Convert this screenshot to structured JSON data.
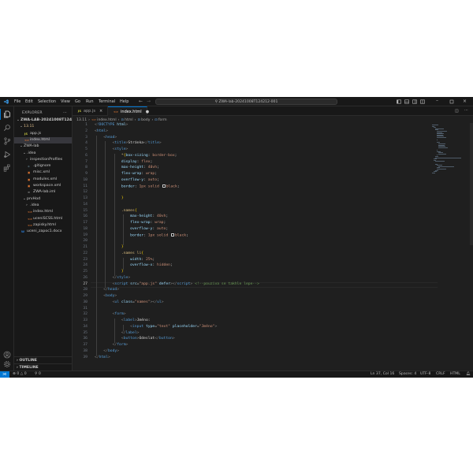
{
  "titlebar": {
    "menu": [
      "File",
      "Edit",
      "Selection",
      "View",
      "Go",
      "Run",
      "Terminal",
      "Help"
    ],
    "command_center": "ZWA-lab-20241008T124212-001"
  },
  "sidebar": {
    "title": "EXPLORER",
    "tree": [
      {
        "label": "ZWA-LAB-20241008T1242...",
        "indent": 0,
        "twisty": "⌄",
        "bold": true,
        "color": "#cccccc"
      },
      {
        "label": "13.11",
        "indent": 1,
        "twisty": "⌄",
        "color": "#e2c08d"
      },
      {
        "label": "app.js",
        "indent": 2,
        "icon": "JS",
        "icon_color": "#cbcb41",
        "color": "#cccccc"
      },
      {
        "label": "index.html",
        "indent": 2,
        "icon": "<>",
        "icon_color": "#e37933",
        "color": "#cccccc",
        "selected": true
      },
      {
        "label": "ZWA-lab",
        "indent": 1,
        "twisty": "⌄",
        "color": "#cccccc"
      },
      {
        "label": ".idea",
        "indent": 2,
        "twisty": "⌄",
        "color": "#cccccc"
      },
      {
        "label": "inspectionProfiles",
        "indent": 3,
        "twisty": "›",
        "color": "#cccccc"
      },
      {
        "label": ".gitignore",
        "indent": 3,
        "icon": "◆",
        "icon_color": "#41535b",
        "color": "#cccccc"
      },
      {
        "label": "misc.xml",
        "indent": 3,
        "icon": "▣",
        "icon_color": "#e37933",
        "color": "#cccccc"
      },
      {
        "label": "modules.xml",
        "indent": 3,
        "icon": "▣",
        "icon_color": "#e37933",
        "color": "#cccccc"
      },
      {
        "label": "workspace.xml",
        "indent": 3,
        "icon": "▣",
        "icon_color": "#e37933",
        "color": "#cccccc"
      },
      {
        "label": "ZWA-lab.iml",
        "indent": 3,
        "icon": "≡",
        "icon_color": "#8a8a8a",
        "color": "#cccccc"
      },
      {
        "label": "prvHod",
        "indent": 2,
        "twisty": "⌄",
        "color": "#cccccc"
      },
      {
        "label": ".idea",
        "indent": 3,
        "twisty": "›",
        "color": "#cccccc"
      },
      {
        "label": "index.html",
        "indent": 3,
        "icon": "<>",
        "icon_color": "#e37933",
        "color": "#cccccc"
      },
      {
        "label": "uceniSCSS.html",
        "indent": 3,
        "icon": "<>",
        "icon_color": "#e37933",
        "color": "#cccccc"
      },
      {
        "label": "zapisky.html",
        "indent": 3,
        "icon": "<>",
        "icon_color": "#e37933",
        "color": "#cccccc"
      },
      {
        "label": "uceni_zapoc1.docx",
        "indent": 1,
        "icon": "W",
        "icon_color": "#2b7cd3",
        "color": "#cccccc"
      }
    ],
    "outline": "OUTLINE",
    "timeline": "TIMELINE"
  },
  "tabs": [
    {
      "label": "app.js",
      "icon": "JS",
      "icon_color": "#cbcb41",
      "active": false,
      "close": "×"
    },
    {
      "label": "index.html",
      "icon": "<>",
      "icon_color": "#e37933",
      "active": true,
      "close": "●"
    }
  ],
  "breadcrumb": [
    "13.11",
    "index.html",
    "html",
    "body",
    "form"
  ],
  "editor": {
    "current_line": 27,
    "lines": [
      {
        "n": 1,
        "html": "<span class=\"p\">&lt;</span><span class=\"t\">!DOCTYPE</span> <span class=\"a\">html</span><span class=\"p\">&gt;</span>"
      },
      {
        "n": 2,
        "html": "<span class=\"p\">&lt;</span><span class=\"t\">html</span><span class=\"p\">&gt;</span>"
      },
      {
        "n": 3,
        "html": "    <span class=\"p\">&lt;</span><span class=\"t\">head</span><span class=\"p\">&gt;</span>"
      },
      {
        "n": 4,
        "html": "        <span class=\"p\">&lt;</span><span class=\"t\">title</span><span class=\"p\">&gt;</span><span class=\"x\">Stránka</span><span class=\"p\">&lt;/</span><span class=\"t\">title</span><span class=\"p\">&gt;</span>"
      },
      {
        "n": 5,
        "html": "        <span class=\"p\">&lt;</span><span class=\"t\">style</span><span class=\"p\">&gt;</span>"
      },
      {
        "n": 6,
        "html": "            <span class=\"sel-t\">*</span><span class=\"y\">{</span><span class=\"a\">box-sizing</span>: <span class=\"v\">border-box</span>;"
      },
      {
        "n": 7,
        "html": "            <span class=\"a\">display</span>: <span class=\"v\">flex</span>;"
      },
      {
        "n": 8,
        "html": "            <span class=\"a\">max-height</span>: <span class=\"v\">40vh</span>;"
      },
      {
        "n": 9,
        "html": "            <span class=\"a\">flex-wrap</span>: <span class=\"v\">wrap</span>;"
      },
      {
        "n": 10,
        "html": "            <span class=\"a\">overflow-y</span>: <span class=\"v\">auto</span>;"
      },
      {
        "n": 11,
        "html": "            <span class=\"a\">border</span>: <span class=\"v\">1px solid</span> <span class=\"sw\"></span><span class=\"v\">black</span>;"
      },
      {
        "n": 12,
        "html": ""
      },
      {
        "n": 13,
        "html": "            <span class=\"y\">}</span>"
      },
      {
        "n": 14,
        "html": ""
      },
      {
        "n": 15,
        "html": "            <span class=\"sel-t\">.names</span><span class=\"y\">{</span>"
      },
      {
        "n": 16,
        "html": "                <span class=\"a\">max-height</span>: <span class=\"v\">40vh</span>;"
      },
      {
        "n": 17,
        "html": "                <span class=\"a\">flex-wrap</span>: <span class=\"v\">wrap</span>;"
      },
      {
        "n": 18,
        "html": "                <span class=\"a\">overflow-y</span>: <span class=\"v\">auto</span>;"
      },
      {
        "n": 19,
        "html": "                <span class=\"a\">border</span>: <span class=\"v\">1px solid</span> <span class=\"sw\"></span><span class=\"v\">black</span>;"
      },
      {
        "n": 20,
        "html": ""
      },
      {
        "n": 21,
        "html": "            <span class=\"y\">}</span>"
      },
      {
        "n": 22,
        "html": "            <span class=\"sel-t\">.names li</span><span class=\"y\">{</span>"
      },
      {
        "n": 23,
        "html": "                <span class=\"a\">width</span>: <span class=\"v\">25%</span>;"
      },
      {
        "n": 24,
        "html": "                <span class=\"a\">overflow-x</span>: <span class=\"v\">hidden</span>;"
      },
      {
        "n": 25,
        "html": "            <span class=\"y\">}</span>"
      },
      {
        "n": 26,
        "html": "        <span class=\"p\">&lt;/</span><span class=\"t\">style</span><span class=\"p\">&gt;</span>"
      },
      {
        "n": 27,
        "html": "        <span class=\"p\">&lt;</span><span class=\"t\">script</span> <span class=\"a\">src</span>=<span class=\"s\">\"app.js\"</span> <span class=\"a\">defer</span><span class=\"p\">&gt;&lt;/</span><span class=\"t\">script</span><span class=\"p\">&gt;</span> <span class=\"c\">&lt;!--pouziva se takhle lepe--&gt;</span>"
      },
      {
        "n": 28,
        "html": "    <span class=\"p\">&lt;/</span><span class=\"t\">head</span><span class=\"p\">&gt;</span>"
      },
      {
        "n": 29,
        "html": "    <span class=\"p\">&lt;</span><span class=\"t\">body</span><span class=\"p\">&gt;</span>"
      },
      {
        "n": 30,
        "html": "        <span class=\"p\">&lt;</span><span class=\"t\">ul</span> <span class=\"a\">class</span>=<span class=\"s\">\"names\"</span><span class=\"p\">&gt;&lt;/</span><span class=\"t\">ul</span><span class=\"p\">&gt;</span>"
      },
      {
        "n": 31,
        "html": ""
      },
      {
        "n": 32,
        "html": "        <span class=\"p\">&lt;</span><span class=\"t\">form</span><span class=\"p\">&gt;</span>"
      },
      {
        "n": 33,
        "html": "            <span class=\"p\">&lt;</span><span class=\"t\">label</span><span class=\"p\">&gt;</span><span class=\"x\">Jméno:</span>"
      },
      {
        "n": 34,
        "html": "                <span class=\"p\">&lt;</span><span class=\"t\">input</span> <span class=\"a\">type</span>=<span class=\"s\">\"text\"</span> <span class=\"a\">placeholder</span>=<span class=\"s\">\"Jméno\"</span><span class=\"p\">&gt;</span>"
      },
      {
        "n": 35,
        "html": "            <span class=\"p\">&lt;/</span><span class=\"t\">label</span><span class=\"p\">&gt;</span>"
      },
      {
        "n": 36,
        "html": "            <span class=\"p\">&lt;</span><span class=\"t\">button</span><span class=\"p\">&gt;</span><span class=\"x\">Odeslat</span><span class=\"p\">&lt;/</span><span class=\"t\">button</span><span class=\"p\">&gt;</span>"
      },
      {
        "n": 37,
        "html": "        <span class=\"p\">&lt;/</span><span class=\"t\">form</span><span class=\"p\">&gt;</span>"
      },
      {
        "n": 38,
        "html": "    <span class=\"p\">&lt;/</span><span class=\"t\">body</span><span class=\"p\">&gt;</span>"
      },
      {
        "n": 39,
        "html": "<span class=\"p\">&lt;/</span><span class=\"t\">html</span><span class=\"p\">&gt;</span>"
      }
    ]
  },
  "statusbar": {
    "errors": "0",
    "warnings": "0",
    "ports": "0",
    "position": "Ln 37, Col 16",
    "spaces": "Spaces: 4",
    "encoding": "UTF-8",
    "eol": "CRLF",
    "language": "HTML"
  },
  "colors": {
    "accent": "#0078d4",
    "background": "#1f1f1f",
    "chrome": "#181818"
  }
}
